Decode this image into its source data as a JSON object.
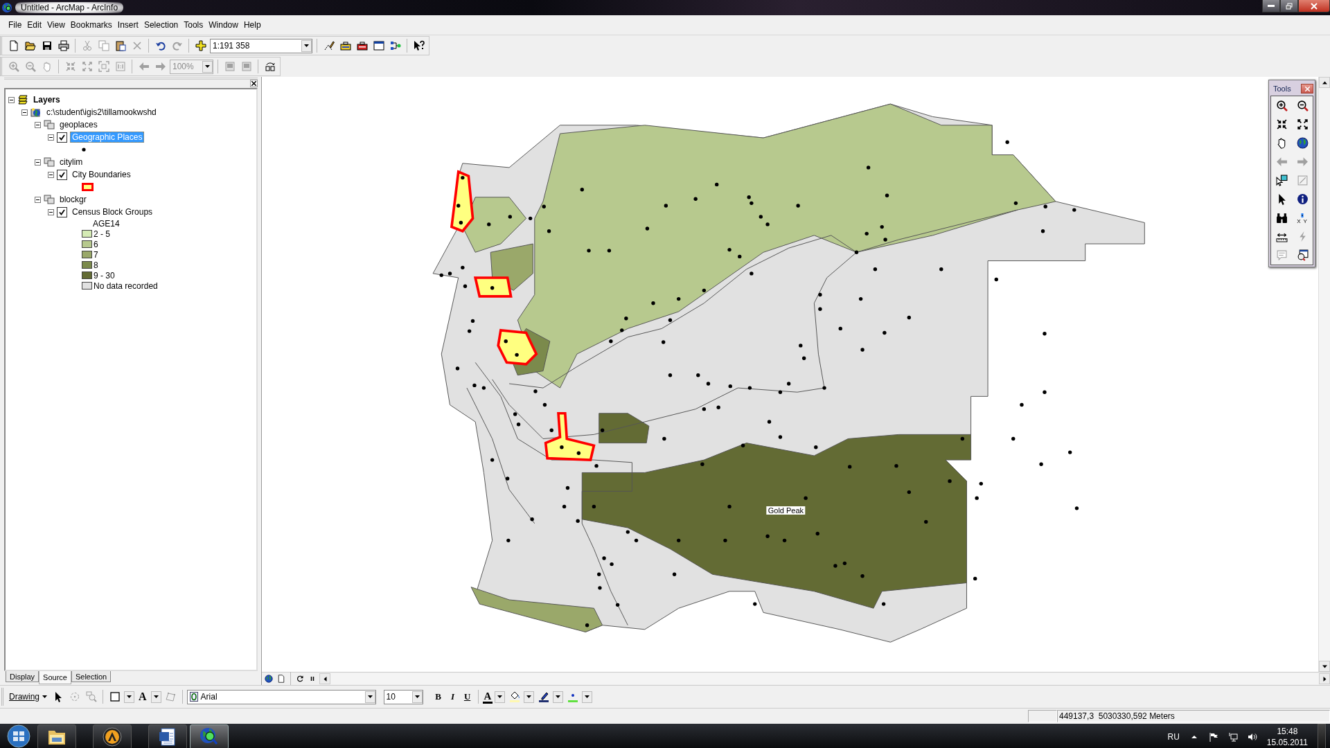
{
  "window": {
    "title": "Untitled - ArcMap - ArcInfo"
  },
  "menu": [
    {
      "label": "File"
    },
    {
      "label": "Edit"
    },
    {
      "label": "View"
    },
    {
      "label": "Bookmarks"
    },
    {
      "label": "Insert"
    },
    {
      "label": "Selection"
    },
    {
      "label": "Tools"
    },
    {
      "label": "Window"
    },
    {
      "label": "Help"
    }
  ],
  "standard_toolbar": {
    "scale": "1:191 358",
    "buttons": [
      {
        "disabled": false
      },
      {
        "disabled": false
      },
      {
        "disabled": false
      },
      {
        "disabled": false
      },
      {
        "disabled": true
      },
      {
        "disabled": true
      },
      {
        "disabled": false
      },
      {
        "disabled": true
      },
      {
        "disabled": false
      },
      {
        "disabled": true
      },
      {
        "disabled": false
      },
      {
        "disabled": false
      },
      {
        "disabled": false
      },
      {
        "disabled": false
      },
      {
        "disabled": false
      },
      {
        "disabled": false
      },
      {
        "disabled": false
      }
    ]
  },
  "layout_toolbar": {
    "zoom": "100%",
    "zoom_disabled": true,
    "buttons": [
      {
        "disabled": true
      },
      {
        "disabled": true
      },
      {
        "disabled": true
      },
      {
        "disabled": true
      },
      {
        "disabled": true
      },
      {
        "disabled": true
      },
      {
        "disabled": true
      },
      {
        "disabled": true
      },
      {
        "disabled": true
      },
      {
        "disabled": true
      },
      {
        "disabled": true
      },
      {
        "disabled": false
      }
    ]
  },
  "toc": {
    "tree": [
      {
        "kind": "dataframe",
        "label": "Layers",
        "expanded": true,
        "selected": false,
        "children": [
          {
            "kind": "workspace",
            "label": "c:\\student\\igis2\\tillamookwshd",
            "expanded": true,
            "selected": false,
            "children": [
              {
                "kind": "group",
                "label": "geoplaces",
                "expanded": true,
                "selected": false,
                "children": [
                  {
                    "kind": "layer",
                    "label": "Geographic Places",
                    "expanded": true,
                    "checked": true,
                    "selected": true,
                    "legend_symbol": {
                      "kind": "point"
                    }
                  }
                ]
              },
              {
                "kind": "group",
                "label": "citylim",
                "expanded": true,
                "selected": false,
                "children": [
                  {
                    "kind": "layer",
                    "label": "City Boundaries",
                    "expanded": true,
                    "checked": true,
                    "selected": false,
                    "legend_symbol": {
                      "kind": "polygon"
                    }
                  }
                ]
              },
              {
                "kind": "group",
                "label": "blockgr",
                "expanded": true,
                "selected": false,
                "children": [
                  {
                    "kind": "layer",
                    "label": "Census Block Groups",
                    "expanded": true,
                    "checked": true,
                    "selected": false,
                    "field": "AGE14",
                    "classes": [
                      {
                        "label": "2 - 5",
                        "color": "#d5ebb5"
                      },
                      {
                        "label": "6",
                        "color": "#b7c98e"
                      },
                      {
                        "label": "7",
                        "color": "#9aa86a"
                      },
                      {
                        "label": "8",
                        "color": "#7b8a4c"
                      },
                      {
                        "label": "9 - 30",
                        "color": "#636b34"
                      },
                      {
                        "label": "No data recorded",
                        "color": "#e1e1e1"
                      }
                    ]
                  }
                ]
              }
            ]
          }
        ]
      }
    ],
    "tabs": [
      {
        "label": "Display",
        "selected": false
      },
      {
        "label": "Source",
        "selected": true
      },
      {
        "label": "Selection",
        "selected": false
      }
    ]
  },
  "map": {
    "labels": [
      {
        "text": "Gold Peak"
      }
    ]
  },
  "tools_window": {
    "title": "Tools",
    "buttons": [
      {
        "disabled": false
      },
      {
        "disabled": false
      },
      {
        "disabled": false
      },
      {
        "disabled": false
      },
      {
        "disabled": false
      },
      {
        "disabled": false
      },
      {
        "disabled": true
      },
      {
        "disabled": true
      },
      {
        "disabled": false
      },
      {
        "disabled": true
      },
      {
        "disabled": false
      },
      {
        "disabled": false
      },
      {
        "disabled": false
      },
      {
        "disabled": false,
        "label": "X Y"
      },
      {
        "disabled": false
      },
      {
        "disabled": true
      },
      {
        "disabled": true
      },
      {
        "disabled": false
      }
    ]
  },
  "drawing_toolbar": {
    "menu": "Drawing",
    "text_tool": "A",
    "font": "Arial",
    "font_size": "10",
    "bold": "B",
    "italic": "I",
    "underline": "U",
    "font_color": "A",
    "buttons": [
      {
        "disabled": false
      },
      {
        "disabled": true
      },
      {
        "disabled": true
      },
      {
        "disabled": false
      },
      {
        "disabled": true
      },
      {
        "disabled": false
      },
      {
        "disabled": false
      },
      {
        "disabled": false
      }
    ]
  },
  "status_bar": {
    "coordinates": "449137,3  5030330,592 Meters"
  },
  "taskbar": {
    "apps": [
      {
        "selected": false
      },
      {
        "selected": false
      },
      {
        "selected": false
      },
      {
        "selected": true
      }
    ],
    "language": "RU",
    "time": "15:48",
    "date": "15.05.2011"
  }
}
